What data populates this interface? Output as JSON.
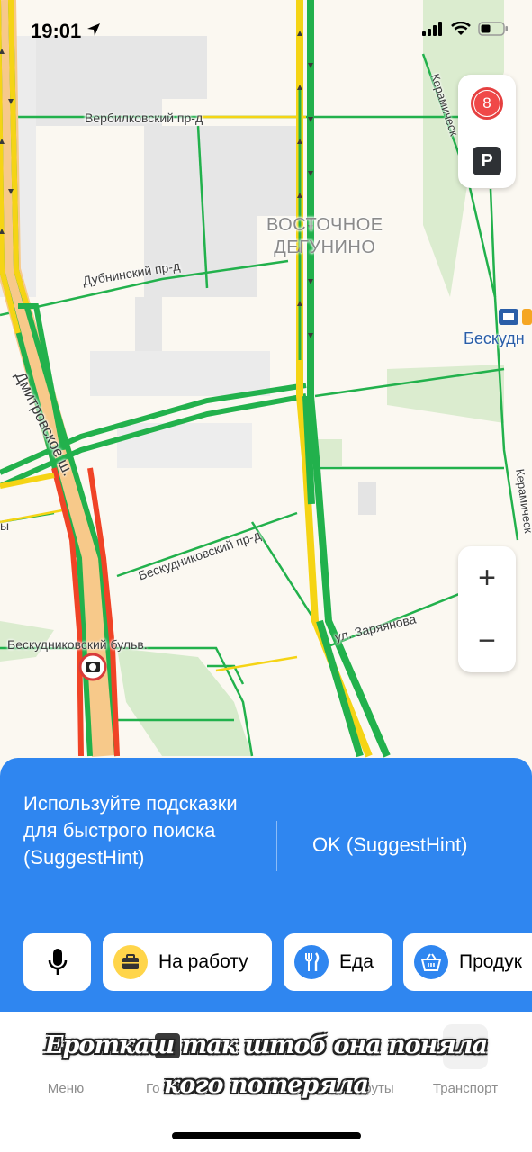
{
  "status_bar": {
    "time": "19:01"
  },
  "map": {
    "district": [
      "ВОСТОЧНОЕ",
      "ДЕГУНИНО"
    ],
    "streets": {
      "verbilkovsky": "Вербилковский пр-д",
      "dubninsky": "Дубнинский пр-д",
      "dmitrovskoe": "Дмитровское ш.",
      "beskudnikovsky_pr": "Бескудниковский пр-д",
      "beskudnikovsky_bulv": "Бескудниковский бульв.",
      "zaryanova": "ул. Заряянова",
      "keramichesky_top": "Керамическ",
      "keramichesky_right": "Керамическ",
      "edge_left": "ы"
    },
    "metro": "Бескудн",
    "traffic_score": "8",
    "parking": "P",
    "zoom_in": "+",
    "zoom_out": "−",
    "colors": {
      "free": "#22b14c",
      "slow": "#f5d415",
      "jam": "#f04326",
      "highway_fill": "#f7c98a"
    }
  },
  "hint": {
    "text": "Используйте подсказки для быстрого поиска (SuggestHint)",
    "ok": "OK (SuggestHint)"
  },
  "chips": [
    {
      "icon": "microphone-icon",
      "label": ""
    },
    {
      "icon": "briefcase-icon",
      "label": "На работу"
    },
    {
      "icon": "fork-knife-icon",
      "label": "Еда"
    },
    {
      "icon": "basket-icon",
      "label": "Продук"
    }
  ],
  "tabs": [
    {
      "label": "Меню"
    },
    {
      "label": "Го"
    },
    {
      "label": ""
    },
    {
      "label": "руты"
    },
    {
      "label": "Транспорт"
    }
  ],
  "caption": {
    "line1": "Ероткаш так штоб она поняла",
    "line2": "кого потеряла"
  }
}
